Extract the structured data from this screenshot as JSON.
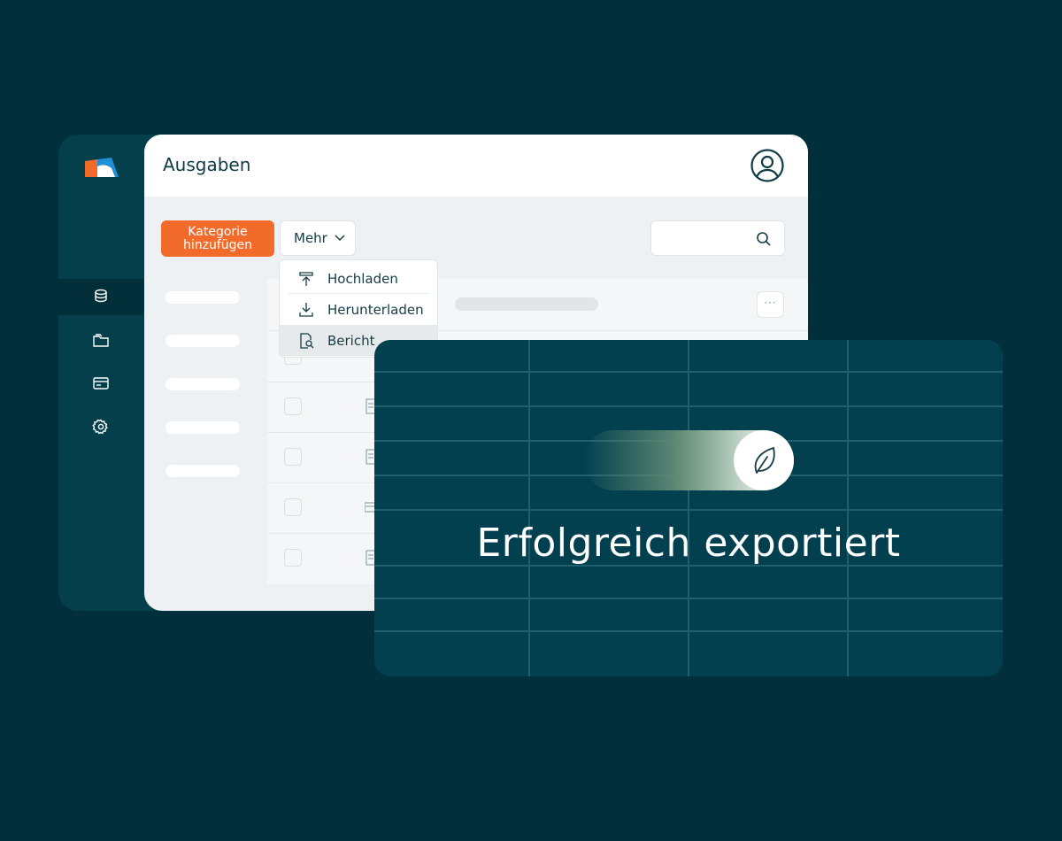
{
  "header": {
    "title": "Ausgaben"
  },
  "toolbar": {
    "add_label": "Kategorie hinzufügen",
    "more_label": "Mehr",
    "search_placeholder": ""
  },
  "dropdown": {
    "items": [
      {
        "label": "Hochladen",
        "icon": "upload-icon"
      },
      {
        "label": "Herunterladen",
        "icon": "download-icon"
      },
      {
        "label": "Bericht",
        "icon": "report-search-icon"
      }
    ]
  },
  "toast": {
    "message": "Erfolgreich exportiert",
    "icon": "leaf-icon"
  },
  "colors": {
    "background": "#01303c",
    "accent": "#f26b2a",
    "card": "#023f4f"
  }
}
